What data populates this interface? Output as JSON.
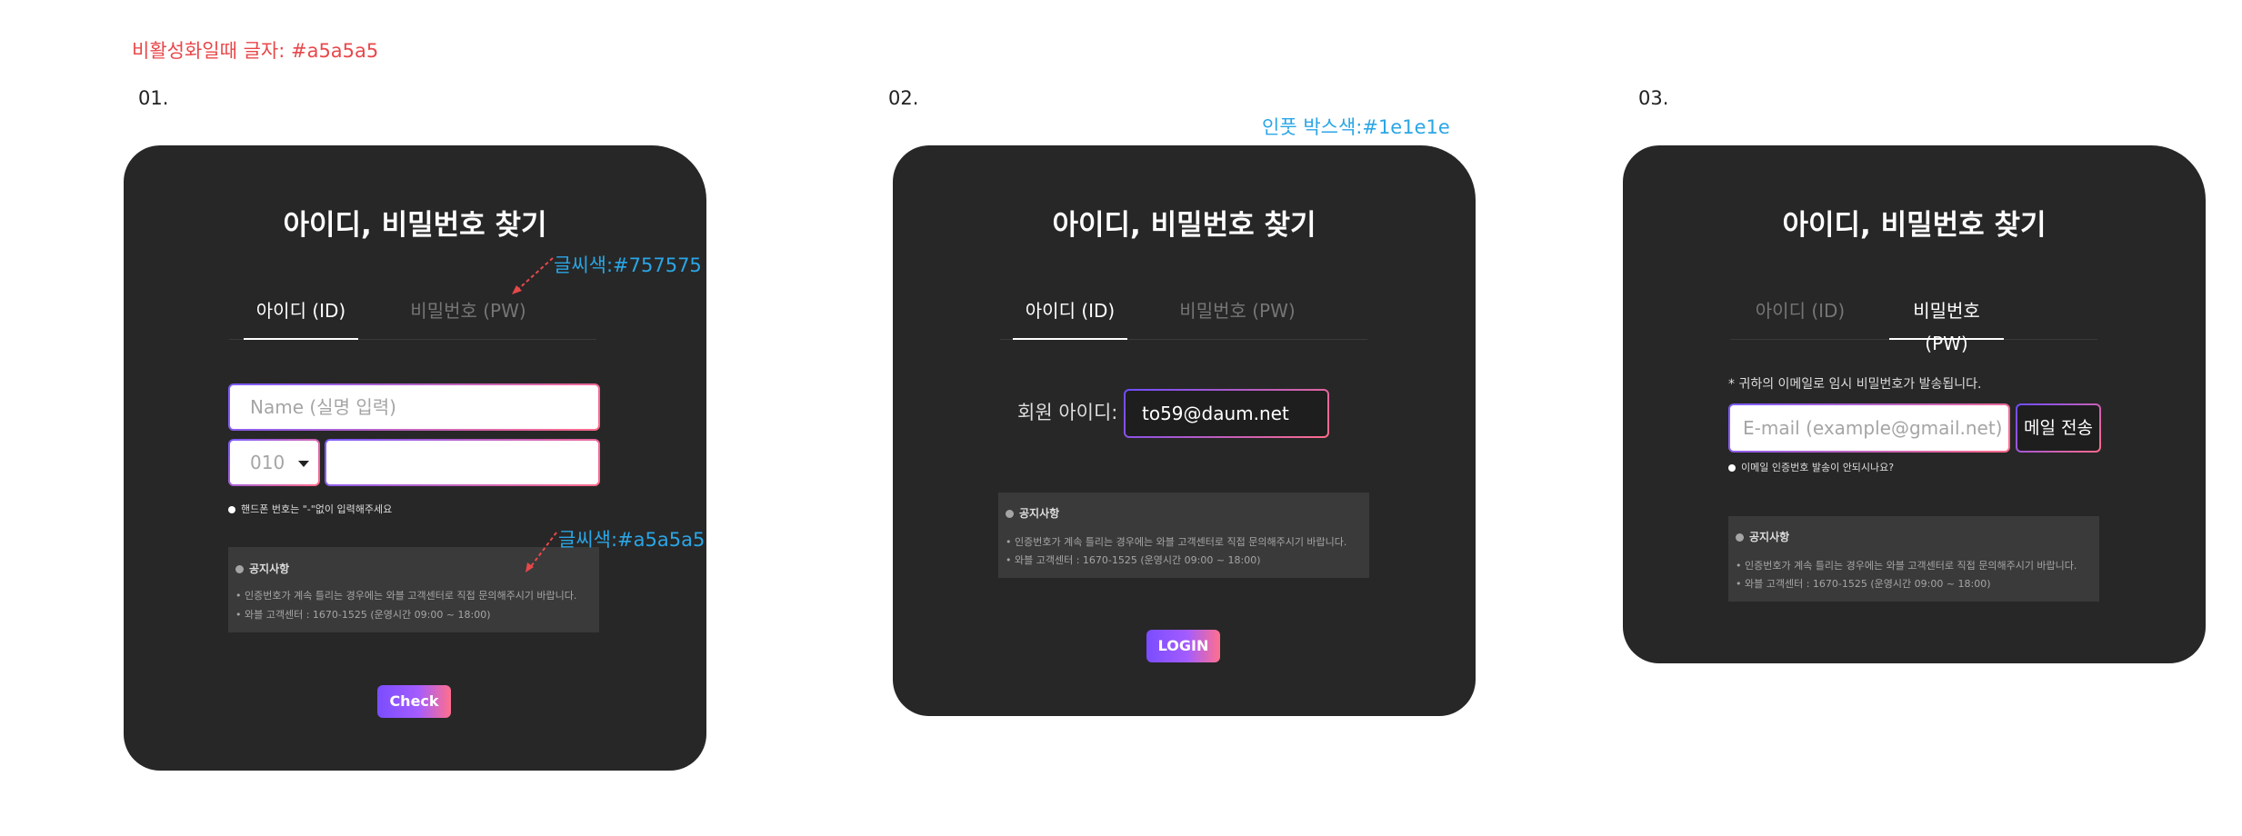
{
  "annotations": {
    "disabled_text": "비활성화일때 글자: #a5a5a5",
    "text_color_757575": "글씨색:#757575",
    "text_color_a5a5a5": "글씨색:#a5a5a5",
    "input_box_color": "인풋 박스색:#1e1e1e"
  },
  "steps": [
    "01.",
    "02.",
    "03."
  ],
  "colors": {
    "card_bg": "#272727",
    "input_bg": "#1e1e1e",
    "inactive_tab": "#757575",
    "disabled_text": "#a5a5a5",
    "accent_start": "#7a4dff",
    "accent_end": "#ff6f8e",
    "note_red": "#e8484b",
    "note_blue": "#2aa6e6"
  },
  "card_title": "아이디, 비밀번호 찾기",
  "tabs": {
    "id": "아이디 (ID)",
    "pw": "비밀번호 (PW)"
  },
  "card1": {
    "name_placeholder": "Name (실명 입력)",
    "phone_prefix": "010",
    "phone_value": "",
    "phone_hint": "핸드폰 번호는 \"-\"없이 입력해주세요",
    "button": "Check"
  },
  "notice": {
    "title": "공지사항",
    "line1": "• 인증번호가 계속 틀리는 경우에는 와블 고객센터로 직접 문의해주시기 바랍니다.",
    "line2": "•  와블 고객센터 : 1670-1525 (운영시간 09:00 ~ 18:00)"
  },
  "card2": {
    "id_label": "회원 아이디:",
    "id_value": "to59@daum.net",
    "button": "LOGIN"
  },
  "card3": {
    "email_note": "* 귀하의 이메일로 임시 비밀번호가 발송됩니다.",
    "email_placeholder": "E-mail (example@gmail.net)",
    "mail_button": "메일 전송",
    "email_hint": "이메일 인증번호 발송이 안되시나요?"
  }
}
